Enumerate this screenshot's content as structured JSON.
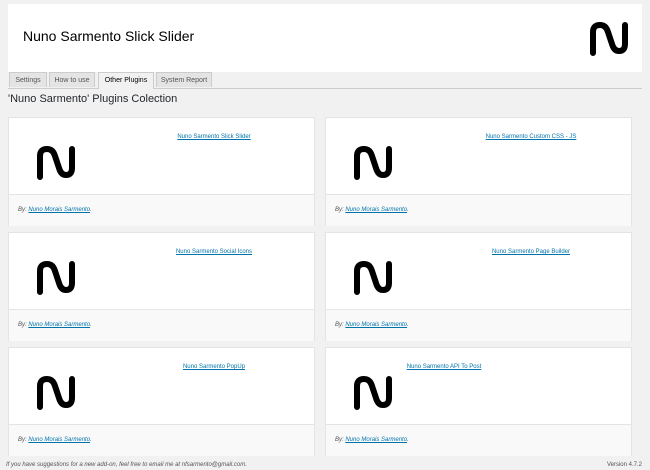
{
  "header": {
    "title": "Nuno Sarmento Slick Slider",
    "logo_icon": "ns-logo-icon"
  },
  "tabs": [
    {
      "label": "Settings",
      "active": false
    },
    {
      "label": "How to use",
      "active": false
    },
    {
      "label": "Other Plugins",
      "active": true
    },
    {
      "label": "System Report",
      "active": false
    }
  ],
  "section": {
    "title": "'Nuno Sarmento' Plugins Colection"
  },
  "cards": [
    {
      "name": "Nuno Sarmento Slick Slider",
      "author_prefix": "By:",
      "author": "Nuno Morais Sarmento",
      "author_suffix": "."
    },
    {
      "name": "Nuno Sarmento Custom CSS - JS",
      "author_prefix": "By:",
      "author": "Nuno Morais Sarmento",
      "author_suffix": "."
    },
    {
      "name": "Nuno Sarmento Social Icons",
      "author_prefix": "By:",
      "author": "Nuno Morais Sarmento",
      "author_suffix": "."
    },
    {
      "name": "Nuno Sarmento Page Builder",
      "author_prefix": "By:",
      "author": "Nuno Morais Sarmento",
      "author_suffix": "."
    },
    {
      "name": "Nuno Sarmento PopUp",
      "author_prefix": "By:",
      "author": "Nuno Morais Sarmento",
      "author_suffix": "."
    },
    {
      "name": "Nuno Sarmento API To Post",
      "author_prefix": "By:",
      "author": "Nuno Morais Sarmento",
      "author_suffix": "."
    }
  ],
  "footer": {
    "left_text": "If you have suggestions for a new add-on, feel free to email me at nfsarmento@gmail.com.",
    "version": "Version 4.7.2"
  },
  "colors": {
    "background": "#f1f1f1",
    "link": "#0073aa",
    "logo": "#000000"
  }
}
